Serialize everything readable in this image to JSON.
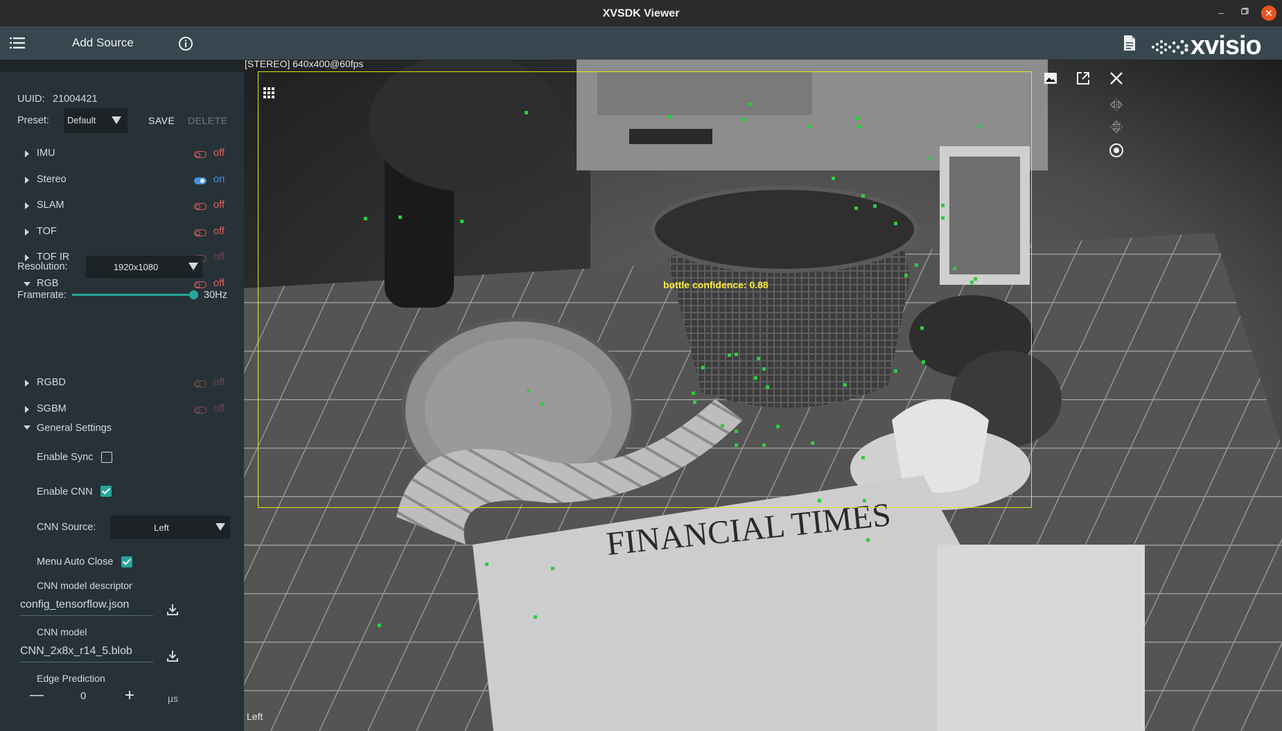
{
  "window": {
    "title": "XVSDK Viewer",
    "minimize_glyph": "–",
    "restore_glyph": "▫",
    "close_glyph": "✕"
  },
  "appbar": {
    "menu_icon": "menu-list-icon",
    "add_source_label": "Add Source",
    "info_icon": "info-circle-icon",
    "doc_icon": "document-icon",
    "logo_text": "xvisio"
  },
  "panel": {
    "uuid_label": "UUID:",
    "uuid_value": "21004421",
    "preset_label": "Preset:",
    "preset_value": "Default",
    "save_label": "SAVE",
    "delete_label": "DELETE",
    "sections": [
      {
        "name": "IMU",
        "state": "off",
        "enabled": true
      },
      {
        "name": "Stereo",
        "state": "on",
        "enabled": true
      },
      {
        "name": "SLAM",
        "state": "off",
        "enabled": true
      },
      {
        "name": "TOF",
        "state": "off",
        "enabled": true
      },
      {
        "name": "TOF IR",
        "state": "off",
        "enabled": false
      },
      {
        "name": "RGB",
        "state": "off",
        "enabled": true
      }
    ],
    "resolution_label": "Resolution:",
    "resolution_value": "1920x1080",
    "framerate_label": "Framerate:",
    "framerate_value": "30Hz",
    "framerate_fraction": 1.0,
    "sections2": [
      {
        "name": "RGBD",
        "state": "off",
        "enabled": false
      },
      {
        "name": "SGBM",
        "state": "off",
        "enabled": false
      }
    ],
    "general_settings_label": "General Settings",
    "enable_sync_label": "Enable Sync",
    "enable_sync_checked": false,
    "enable_cnn_label": "Enable CNN",
    "enable_cnn_checked": true,
    "cnn_source_label": "CNN Source:",
    "cnn_source_value": "Left",
    "menu_auto_close_label": "Menu Auto Close",
    "menu_auto_close_checked": true,
    "cnn_descriptor_label": "CNN model descriptor",
    "cnn_descriptor_value": "config_tensorflow.json",
    "cnn_model_label": "CNN model",
    "cnn_model_value": "CNN_2x8x_r14_5.blob",
    "edge_prediction_label": "Edge Prediction",
    "edge_prediction_minus": "—",
    "edge_prediction_value": "0",
    "edge_prediction_plus": "+",
    "edge_prediction_unit": "µs"
  },
  "video": {
    "stream_label": "[STEREO]  640x400@60fps",
    "detection_label": "bottle confidence: 0.88",
    "source_label": "Left",
    "headline": "FINANCIAL TIMES",
    "icons": [
      "image-icon",
      "open-external-icon",
      "close-icon",
      "rotate-icon",
      "flip-icon",
      "record-icon",
      "grid-icon"
    ]
  }
}
